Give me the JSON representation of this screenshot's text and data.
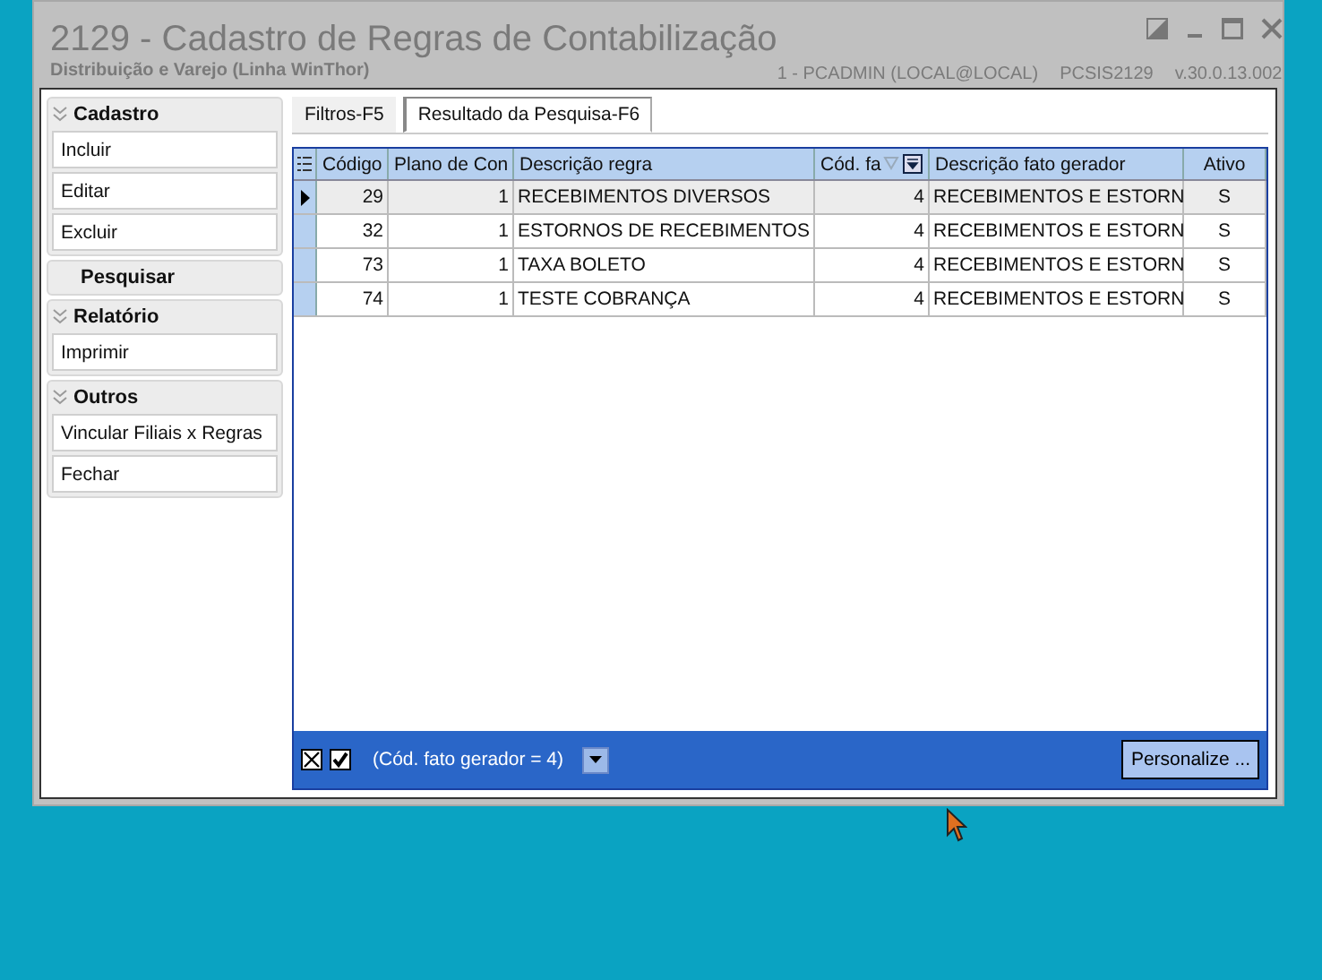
{
  "window": {
    "title": "2129 - Cadastro de Regras de Contabilização",
    "subtitle": "Distribuição e Varejo (Linha WinThor)",
    "user": "1 - PCADMIN (LOCAL@LOCAL)",
    "program": "PCSIS2129",
    "version": "v.30.0.13.002"
  },
  "sidebar": {
    "groups": [
      {
        "title": "Cadastro",
        "kind": "collapsible",
        "items": [
          "Incluir",
          "Editar",
          "Excluir"
        ]
      },
      {
        "title": "Pesquisar",
        "kind": "plain"
      },
      {
        "title": "Relatório",
        "kind": "collapsible",
        "items": [
          "Imprimir"
        ]
      },
      {
        "title": "Outros",
        "kind": "collapsible",
        "items": [
          "Vincular Filiais x Regras",
          "Fechar"
        ]
      }
    ]
  },
  "tabs": [
    {
      "label": "Filtros-F5",
      "selected": false
    },
    {
      "label": "Resultado da Pesquisa-F6",
      "selected": true
    }
  ],
  "table": {
    "columns": [
      {
        "label": "Código",
        "filtered": false
      },
      {
        "label": "Plano de Con",
        "filtered": false
      },
      {
        "label": "Descrição regra",
        "filtered": false
      },
      {
        "label": "Cód. fa",
        "filtered": true
      },
      {
        "label": "Descrição fato gerador",
        "filtered": false
      },
      {
        "label": "Ativo",
        "filtered": false
      }
    ],
    "rows": [
      {
        "selected": true,
        "cells": [
          "29",
          "1",
          "RECEBIMENTOS DIVERSOS",
          "4",
          "RECEBIMENTOS E ESTORN",
          "S"
        ]
      },
      {
        "selected": false,
        "cells": [
          "32",
          "1",
          "ESTORNOS DE RECEBIMENTOS",
          "4",
          "RECEBIMENTOS E ESTORN",
          "S"
        ]
      },
      {
        "selected": false,
        "cells": [
          "73",
          "1",
          "TAXA BOLETO",
          "4",
          "RECEBIMENTOS E ESTORN",
          "S"
        ]
      },
      {
        "selected": false,
        "cells": [
          "74",
          "1",
          "TESTE COBRANÇA",
          "4",
          "RECEBIMENTOS E ESTORN",
          "S"
        ]
      }
    ]
  },
  "filter_bar": {
    "enabled": true,
    "expression": "(Cód. fato gerador = 4)",
    "button": "Personalize ..."
  }
}
